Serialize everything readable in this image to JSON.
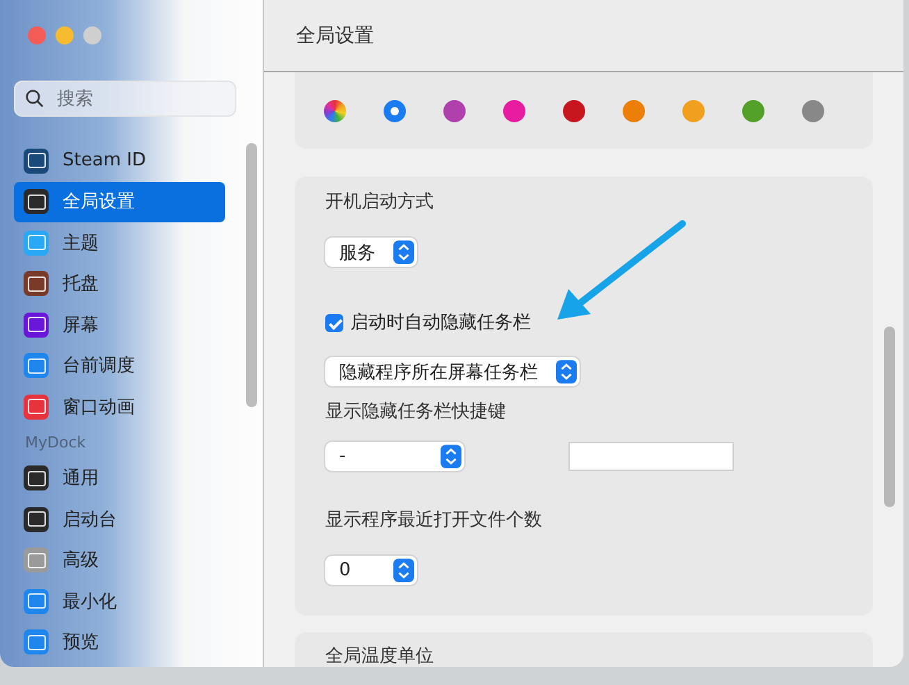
{
  "window": {
    "title": "全局设置"
  },
  "sidebar": {
    "search": {
      "placeholder": "搜索"
    },
    "items": [
      {
        "kind": "item",
        "label": "Steam ID",
        "color": "#1b4a7a",
        "selected": false
      },
      {
        "kind": "item",
        "label": "全局设置",
        "color": "#2a2a2a",
        "selected": true
      },
      {
        "kind": "item",
        "label": "主题",
        "color": "#29a8f5",
        "selected": false
      },
      {
        "kind": "item",
        "label": "托盘",
        "color": "#7a3a2a",
        "selected": false
      },
      {
        "kind": "item",
        "label": "屏幕",
        "color": "#6a16d8",
        "selected": false
      },
      {
        "kind": "item",
        "label": "台前调度",
        "color": "#1f86ee",
        "selected": false
      },
      {
        "kind": "item",
        "label": "窗口动画",
        "color": "#e8323c",
        "selected": false
      },
      {
        "kind": "heading",
        "label": "MyDock"
      },
      {
        "kind": "item",
        "label": "通用",
        "color": "#2a2a2a",
        "selected": false
      },
      {
        "kind": "item",
        "label": "启动台",
        "color": "#2a2a2a",
        "selected": false
      },
      {
        "kind": "item",
        "label": "高级",
        "color": "#9a9a9a",
        "selected": false
      },
      {
        "kind": "item",
        "label": "最小化",
        "color": "#1f86ee",
        "selected": false
      },
      {
        "kind": "item",
        "label": "预览",
        "color": "#1f86ee",
        "selected": false
      }
    ]
  },
  "accent_colors": [
    {
      "kind": "multicolor",
      "selected": false
    },
    {
      "kind": "solid",
      "color": "#1a7cf0",
      "selected": true
    },
    {
      "kind": "solid",
      "color": "#b040ac",
      "selected": false
    },
    {
      "kind": "solid",
      "color": "#e81ca0",
      "selected": false
    },
    {
      "kind": "solid",
      "color": "#c8161e",
      "selected": false
    },
    {
      "kind": "solid",
      "color": "#ec7e0a",
      "selected": false
    },
    {
      "kind": "solid",
      "color": "#f0a01e",
      "selected": false
    },
    {
      "kind": "solid",
      "color": "#52a028",
      "selected": false
    },
    {
      "kind": "solid",
      "color": "#888888",
      "selected": false
    }
  ],
  "startup_card": {
    "items": [
      {
        "kind": "label",
        "text": "开机启动方式"
      },
      {
        "kind": "select",
        "value": "服务"
      },
      {
        "kind": "divider"
      },
      {
        "kind": "checkbox",
        "text": "启动时自动隐藏任务栏",
        "checked": true
      },
      {
        "kind": "select",
        "value": "隐藏程序所在屏幕任务栏"
      },
      {
        "kind": "label",
        "text": "显示隐藏任务栏快捷键"
      },
      {
        "kind": "select_input",
        "value": "-"
      },
      {
        "kind": "divider"
      },
      {
        "kind": "label",
        "text": "显示程序最近打开文件个数"
      },
      {
        "kind": "select",
        "value": "0"
      }
    ]
  },
  "temperature_card": {
    "label": "全局温度单位"
  }
}
